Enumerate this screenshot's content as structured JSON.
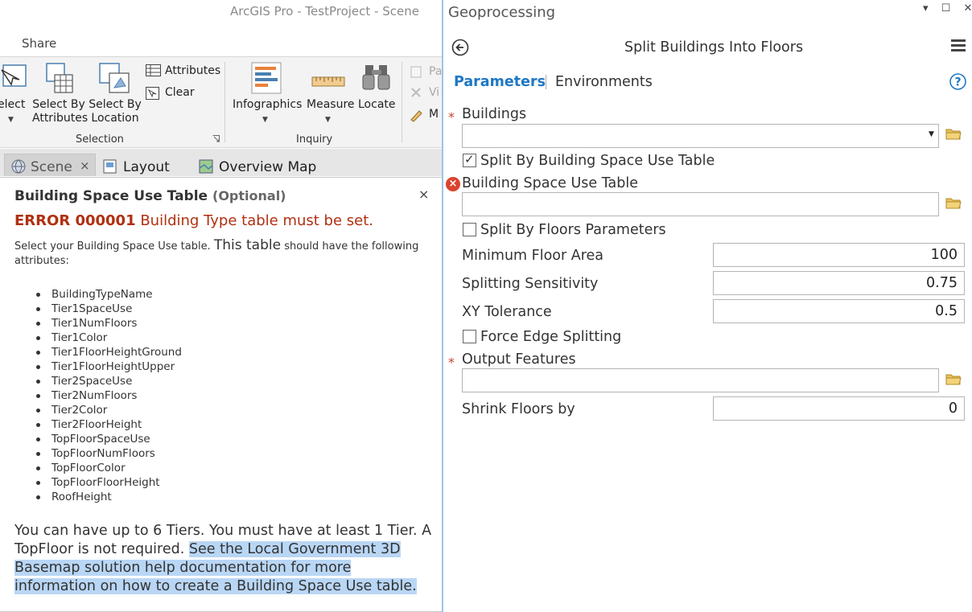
{
  "app": {
    "title": "ArcGIS Pro - TestProject - Scene",
    "tab_share": "Share"
  },
  "ribbon": {
    "select_label": "elect",
    "select_by_attributes": [
      "Select By",
      "Attributes"
    ],
    "select_by_location": [
      "Select By",
      "Location"
    ],
    "attributes": "Attributes",
    "clear": "Clear",
    "selection_group": "Selection",
    "infographics": "Infographics",
    "measure": "Measure",
    "locate": "Locate",
    "inquiry_group": "Inquiry",
    "cut_items": [
      "Pa",
      "Vi",
      "M"
    ]
  },
  "view_tabs": [
    {
      "label": "Scene",
      "close": "×"
    },
    {
      "label": "Layout"
    },
    {
      "label": "Overview Map"
    }
  ],
  "help_popup": {
    "title": "Building Space Use Table",
    "title_optional": "(Optional)",
    "close": "×",
    "error_code": "ERROR 000001",
    "error_message": "Building Type table must be set.",
    "intro_a": "Select your Building Space Use table.",
    "intro_big": "This table",
    "intro_b": "should have the following attributes:",
    "attributes": [
      "BuildingTypeName",
      "Tier1SpaceUse",
      "Tier1NumFloors",
      "Tier1Color",
      "Tier1FloorHeightGround",
      "Tier1FloorHeightUpper",
      "Tier2SpaceUse",
      "Tier2NumFloors",
      "Tier2Color",
      "Tier2FloorHeight",
      "TopFloorSpaceUse",
      "TopFloorNumFloors",
      "TopFloorColor",
      "TopFloorFloorHeight",
      "RoofHeight"
    ],
    "footer_plain": "You can have up to 6 Tiers. You must have at least 1 Tier. A TopFloor is not required.",
    "footer_highlight": "See the Local Government 3D Basemap solution help documentation for more information on how to create a Building Space Use table."
  },
  "geoprocessing": {
    "pane_title": "Geoprocessing",
    "window_controls": "▾ ☐ ✕",
    "tool_title": "Split Buildings Into Floors",
    "tab_parameters": "Parameters",
    "tab_environments": "Environments",
    "required_mark": "*",
    "params": {
      "buildings": {
        "label": "Buildings",
        "value": ""
      },
      "split_by_table": {
        "label": "Split By Building Space Use Table",
        "checked": true
      },
      "space_use_table": {
        "label": "Building Space Use Table",
        "value": ""
      },
      "split_by_floors": {
        "label": "Split By Floors Parameters",
        "checked": false
      },
      "min_floor_area": {
        "label": "Minimum Floor Area",
        "value": "100"
      },
      "splitting_sensitivity": {
        "label": "Splitting Sensitivity",
        "value": "0.75"
      },
      "xy_tolerance": {
        "label": "XY Tolerance",
        "value": "0.5"
      },
      "force_edge": {
        "label": "Force Edge Splitting",
        "checked": false
      },
      "output_features": {
        "label": "Output Features",
        "value": ""
      },
      "shrink_floors": {
        "label": "Shrink Floors by",
        "value": "0"
      }
    }
  },
  "colors": {
    "accent": "#1f78c4",
    "error": "#b03010",
    "highlight": "#b9d6f5",
    "required": "#c8452b"
  }
}
